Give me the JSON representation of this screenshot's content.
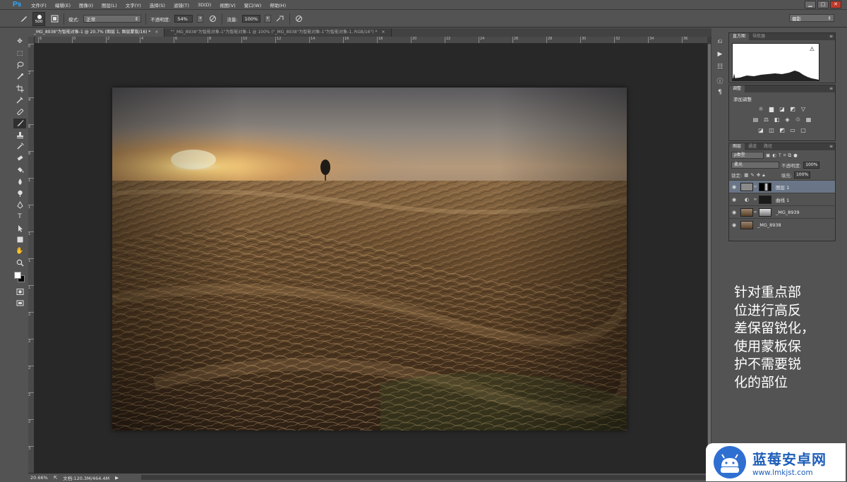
{
  "app": {
    "logo": "Ps"
  },
  "menu": [
    "文件(F)",
    "编辑(E)",
    "图像(I)",
    "图层(L)",
    "文字(Y)",
    "选择(S)",
    "滤镜(T)",
    "3D(D)",
    "视图(V)",
    "窗口(W)",
    "帮助(H)"
  ],
  "window_controls": {
    "minimize": "▁",
    "maximize": "▢",
    "close": "✕"
  },
  "options": {
    "brush_size": "500",
    "mode_label": "模式:",
    "mode_value": "正常",
    "opacity_label": "不透明度:",
    "opacity_value": "54%",
    "flow_label": "流量:",
    "flow_value": "100%",
    "workspace": "摄影"
  },
  "tabs": [
    {
      "label": "_MG_8938\"为智能对象-1 @ 20.7% (图层 1, 图层蒙版/16) *",
      "close": "×",
      "active": true
    },
    {
      "label": "\"\"_MG_8938\"为智能对象-1\"为智能对象-1 @ 100% (\"_MG_8938\"为智能对象-1\"为智能对象-1, RGB/16\") *",
      "close": "×",
      "active": false
    }
  ],
  "ruler_top": [
    "6",
    "0",
    "2",
    "4",
    "6",
    "8",
    "10",
    "12",
    "14",
    "16",
    "18",
    "20",
    "22",
    "24",
    "26",
    "28",
    "30",
    "32",
    "34",
    "36"
  ],
  "ruler_left": [
    "0",
    "2",
    "4",
    "6",
    "8",
    "1",
    "1",
    "1",
    "1",
    "1",
    "2",
    "2",
    "2",
    "2",
    "2",
    "3"
  ],
  "status": {
    "zoom": "20.66%",
    "doc": "文档:120.3M/464.4M"
  },
  "panels": {
    "histogram": {
      "tabs": [
        "直方图",
        "导航器"
      ]
    },
    "adjustments": {
      "tabs": [
        "调整"
      ],
      "title": "添加调整"
    },
    "layers": {
      "tabs": [
        "图层",
        "通道",
        "路径"
      ],
      "filter": "ρ类型",
      "blend": "柔光",
      "opacity_label": "不透明度:",
      "opacity_value": "100%",
      "lock_label": "锁定:",
      "fill_label": "填充:",
      "fill_value": "100%",
      "items": [
        {
          "name": "图层 1",
          "selected": true
        },
        {
          "name": "曲线 1",
          "selected": false
        },
        {
          "name": "_MG_8939",
          "selected": false
        },
        {
          "name": "_MG_8938",
          "selected": false
        }
      ]
    }
  },
  "annotation": [
    "针对重点部",
    "位进行高反",
    "差保留锐化，",
    "使用蒙板保",
    "护不需要锐",
    "化的部位"
  ],
  "watermark": {
    "title": "蓝莓安卓网",
    "url": "www.lmkjst.com"
  }
}
